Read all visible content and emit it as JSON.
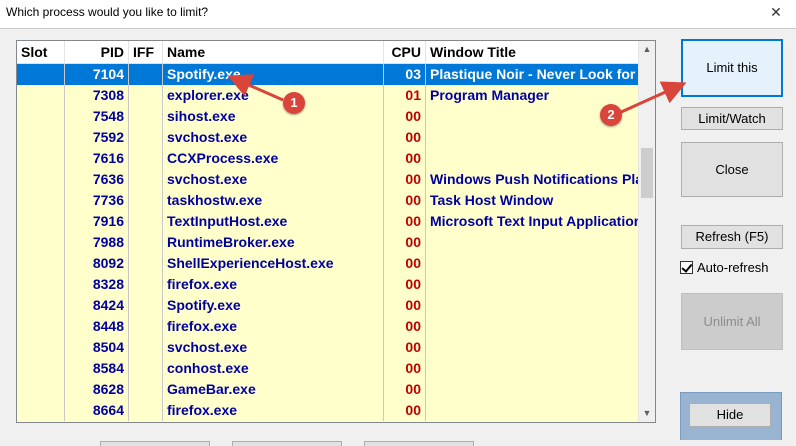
{
  "window": {
    "title": "Which process would you like to limit?",
    "close_glyph": "✕"
  },
  "list": {
    "columns": [
      "Slot",
      "PID",
      "IFF",
      "Name",
      "CPU",
      "Window Title"
    ],
    "rows": [
      {
        "slot": "",
        "pid": "7104",
        "iff": "",
        "name": "Spotify.exe",
        "cpu": "03",
        "title": "Plastique Noir - Never Look for P",
        "selected": true
      },
      {
        "slot": "",
        "pid": "7308",
        "iff": "",
        "name": "explorer.exe",
        "cpu": "01",
        "title": "Program Manager"
      },
      {
        "slot": "",
        "pid": "7548",
        "iff": "",
        "name": "sihost.exe",
        "cpu": "00",
        "title": ""
      },
      {
        "slot": "",
        "pid": "7592",
        "iff": "",
        "name": "svchost.exe",
        "cpu": "00",
        "title": ""
      },
      {
        "slot": "",
        "pid": "7616",
        "iff": "",
        "name": "CCXProcess.exe",
        "cpu": "00",
        "title": ""
      },
      {
        "slot": "",
        "pid": "7636",
        "iff": "",
        "name": "svchost.exe",
        "cpu": "00",
        "title": "Windows Push Notifications Platf"
      },
      {
        "slot": "",
        "pid": "7736",
        "iff": "",
        "name": "taskhostw.exe",
        "cpu": "00",
        "title": "Task Host Window"
      },
      {
        "slot": "",
        "pid": "7916",
        "iff": "",
        "name": "TextInputHost.exe",
        "cpu": "00",
        "title": "Microsoft Text Input Application"
      },
      {
        "slot": "",
        "pid": "7988",
        "iff": "",
        "name": "RuntimeBroker.exe",
        "cpu": "00",
        "title": ""
      },
      {
        "slot": "",
        "pid": "8092",
        "iff": "",
        "name": "ShellExperienceHost.exe",
        "cpu": "00",
        "title": ""
      },
      {
        "slot": "",
        "pid": "8328",
        "iff": "",
        "name": "firefox.exe",
        "cpu": "00",
        "title": ""
      },
      {
        "slot": "",
        "pid": "8424",
        "iff": "",
        "name": "Spotify.exe",
        "cpu": "00",
        "title": ""
      },
      {
        "slot": "",
        "pid": "8448",
        "iff": "",
        "name": "firefox.exe",
        "cpu": "00",
        "title": ""
      },
      {
        "slot": "",
        "pid": "8504",
        "iff": "",
        "name": "svchost.exe",
        "cpu": "00",
        "title": ""
      },
      {
        "slot": "",
        "pid": "8584",
        "iff": "",
        "name": "conhost.exe",
        "cpu": "00",
        "title": ""
      },
      {
        "slot": "",
        "pid": "8628",
        "iff": "",
        "name": "GameBar.exe",
        "cpu": "00",
        "title": ""
      },
      {
        "slot": "",
        "pid": "8664",
        "iff": "",
        "name": "firefox.exe",
        "cpu": "00",
        "title": ""
      }
    ]
  },
  "buttons": {
    "limit_this": "Limit this",
    "limit_watch": "Limit/Watch",
    "close": "Close",
    "refresh": "Refresh (F5)",
    "unlimit_all": "Unlimit All",
    "hide": "Hide"
  },
  "auto_refresh": {
    "label": "Auto-refresh",
    "checked": true
  },
  "annotations": [
    {
      "number": "1",
      "color": "#d9443b"
    },
    {
      "number": "2",
      "color": "#d9443b"
    }
  ],
  "colors": {
    "list_bg": "#ffffcc",
    "selected_row": "#0078d7",
    "process_text": "#0000a0",
    "cpu_text": "#c00000",
    "annotation_red": "#d9443b"
  }
}
